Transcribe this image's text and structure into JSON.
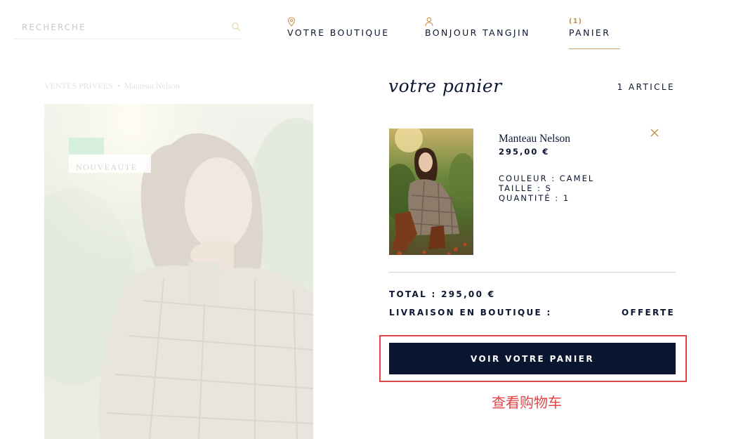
{
  "header": {
    "search": {
      "placeholder": "RECHERCHE",
      "value": ""
    },
    "nav": {
      "boutique_label": "VOTRE BOUTIQUE",
      "account_label": "BONJOUR TANGJIN",
      "cart_count_badge": "(1)",
      "cart_label": "PANIER"
    }
  },
  "product_page": {
    "breadcrumb": {
      "parent": "VENTES PRIVEES",
      "separator": "•",
      "current": "Manteau Nelson"
    },
    "new_tag": "NOUVEAUTE"
  },
  "cart": {
    "title": "votre panier",
    "count_label": "1 ARTICLE",
    "items": [
      {
        "name": "Manteau Nelson",
        "price": "295,00 €",
        "color": "COULEUR : CAMEL",
        "size": "TAILLE : S",
        "quantity": "QUANTITÉ : 1"
      }
    ],
    "total": "TOTAL : 295,00 €",
    "delivery_label": "LIVRAISON EN BOUTIQUE :",
    "delivery_value": "OFFERTE",
    "cta_label": "VOIR VOTRE PANIER"
  },
  "annotation": {
    "text": "查看购物车",
    "color": "#e04545"
  },
  "colors": {
    "navy": "#0a1530",
    "gold": "#c8924a",
    "highlight_red": "#e04545"
  },
  "icons": [
    "search-icon",
    "location-pin-icon",
    "user-icon",
    "close-icon"
  ]
}
